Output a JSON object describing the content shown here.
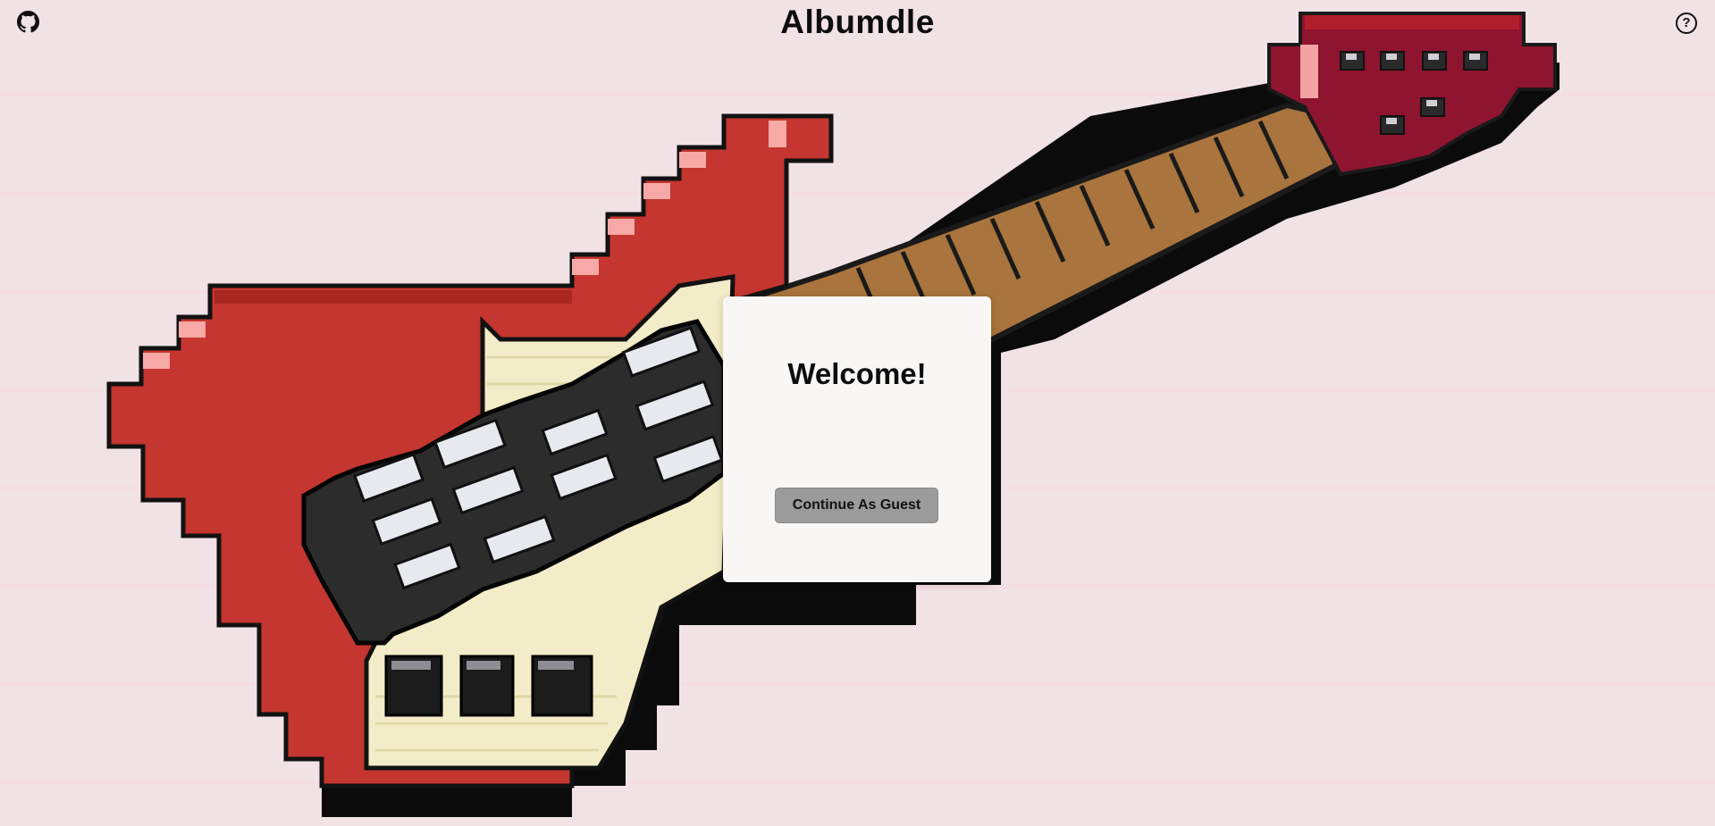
{
  "header": {
    "title": "Albumdle"
  },
  "toolbar": {
    "github_icon": "github-icon",
    "help_label": "?"
  },
  "modal": {
    "title": "Welcome!",
    "guest_button_label": "Continue As Guest"
  },
  "colors": {
    "background": "#f1e2e6",
    "modal_background": "#f8f7f5",
    "button_gray": "#9b9b9b",
    "guitar_red": "#c4362f",
    "guitar_cream": "#f3ecc8",
    "fretboard_brown": "#a9743d"
  }
}
